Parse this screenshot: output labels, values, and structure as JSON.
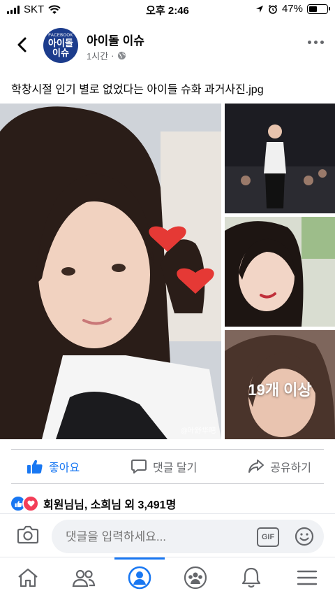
{
  "status": {
    "carrier": "SKT",
    "time": "오후 2:46",
    "battery": "47%",
    "battery_level": 0.47
  },
  "post": {
    "page_name": "아이돌 이슈",
    "logo_small": "FACEBOOK",
    "logo_line1": "아이돌",
    "logo_line2": "이슈",
    "time_ago": "1시간",
    "dot": "·",
    "caption": "학창시절 인기 별로 없었다는 아이들 슈화 과거사진.jpg",
    "more_photos": "19개 이상",
    "watermark": "@叶舒华吧"
  },
  "actions": {
    "like": "좋아요",
    "comment": "댓글 달기",
    "share": "공유하기"
  },
  "reactions": {
    "summary": "회원님님, 소희님 외 3,491명"
  },
  "comment_bar": {
    "placeholder": "댓글을 입력하세요...",
    "gif": "GIF"
  },
  "colors": {
    "accent": "#1877f2",
    "love": "#f33e58",
    "logo_bg": "#1c3c8c"
  },
  "icons": [
    "back-arrow-icon",
    "globe-icon",
    "more-icon",
    "like-icon",
    "comment-icon",
    "share-icon",
    "camera-icon",
    "gif-icon",
    "emoji-icon",
    "home-icon",
    "friends-icon",
    "profile-icon",
    "groups-icon",
    "bell-icon",
    "menu-icon"
  ]
}
